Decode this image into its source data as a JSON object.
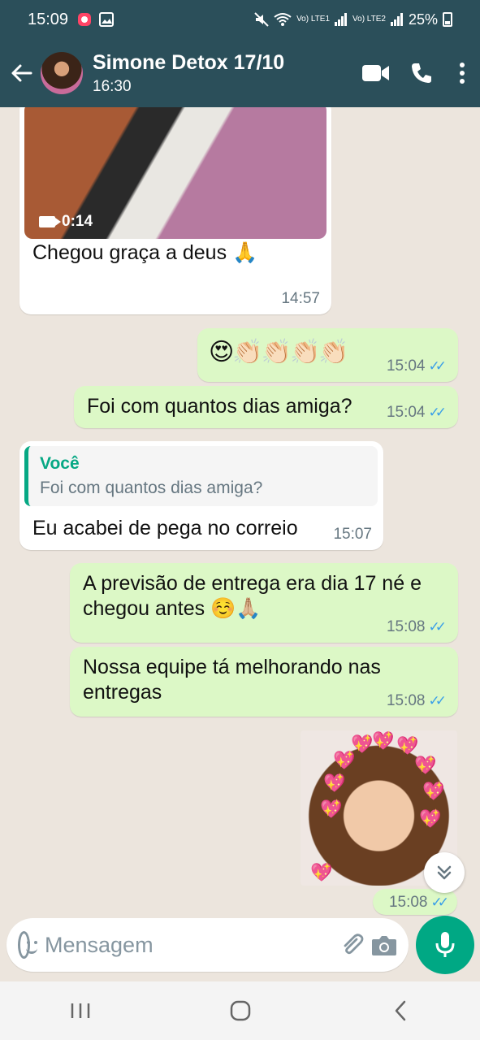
{
  "status_bar": {
    "time": "15:09",
    "sim1": "Vo) LTE1",
    "sim2": "Vo) LTE2",
    "battery": "25%"
  },
  "header": {
    "contact_name": "Simone Detox 17/10",
    "subtitle": "16:30"
  },
  "messages": [
    {
      "direction": "in",
      "type": "video",
      "duration": "0:14",
      "caption": "Chegou graça a deus 🙏",
      "time": "14:57"
    },
    {
      "direction": "out",
      "type": "text",
      "text": "😍👏🏻👏🏻👏🏻👏🏻",
      "time": "15:04",
      "read": true
    },
    {
      "direction": "out",
      "type": "text",
      "text": "Foi com quantos dias amiga?",
      "time": "15:04",
      "read": true
    },
    {
      "direction": "in",
      "type": "reply",
      "quoted_author": "Você",
      "quoted_text": "Foi com quantos dias amiga?",
      "text": "Eu acabei de pega no correio",
      "time": "15:07"
    },
    {
      "direction": "out",
      "type": "text",
      "text": "A previsão de entrega era dia 17 né e chegou antes ☺️🙏🏼",
      "time": "15:08",
      "read": true
    },
    {
      "direction": "out",
      "type": "text",
      "text": "Nossa equipe tá melhorando nas entregas",
      "time": "15:08",
      "read": true
    },
    {
      "direction": "out",
      "type": "sticker",
      "time": "15:08",
      "read": true
    }
  ],
  "composer": {
    "placeholder": "Mensagem"
  },
  "colors": {
    "appbar": "#2b4f5a",
    "outgoing_bubble": "#dcf8c6",
    "incoming_bubble": "#ffffff",
    "accent": "#00a884",
    "read_ticks": "#3a9fe8"
  },
  "icons": {
    "back": "back-arrow-icon",
    "video_call": "video-call-icon",
    "voice_call": "phone-icon",
    "menu": "more-vert-icon",
    "emoji": "emoji-icon",
    "attach": "paperclip-icon",
    "camera": "camera-icon",
    "mic": "mic-icon",
    "scroll": "chevron-double-down-icon"
  }
}
